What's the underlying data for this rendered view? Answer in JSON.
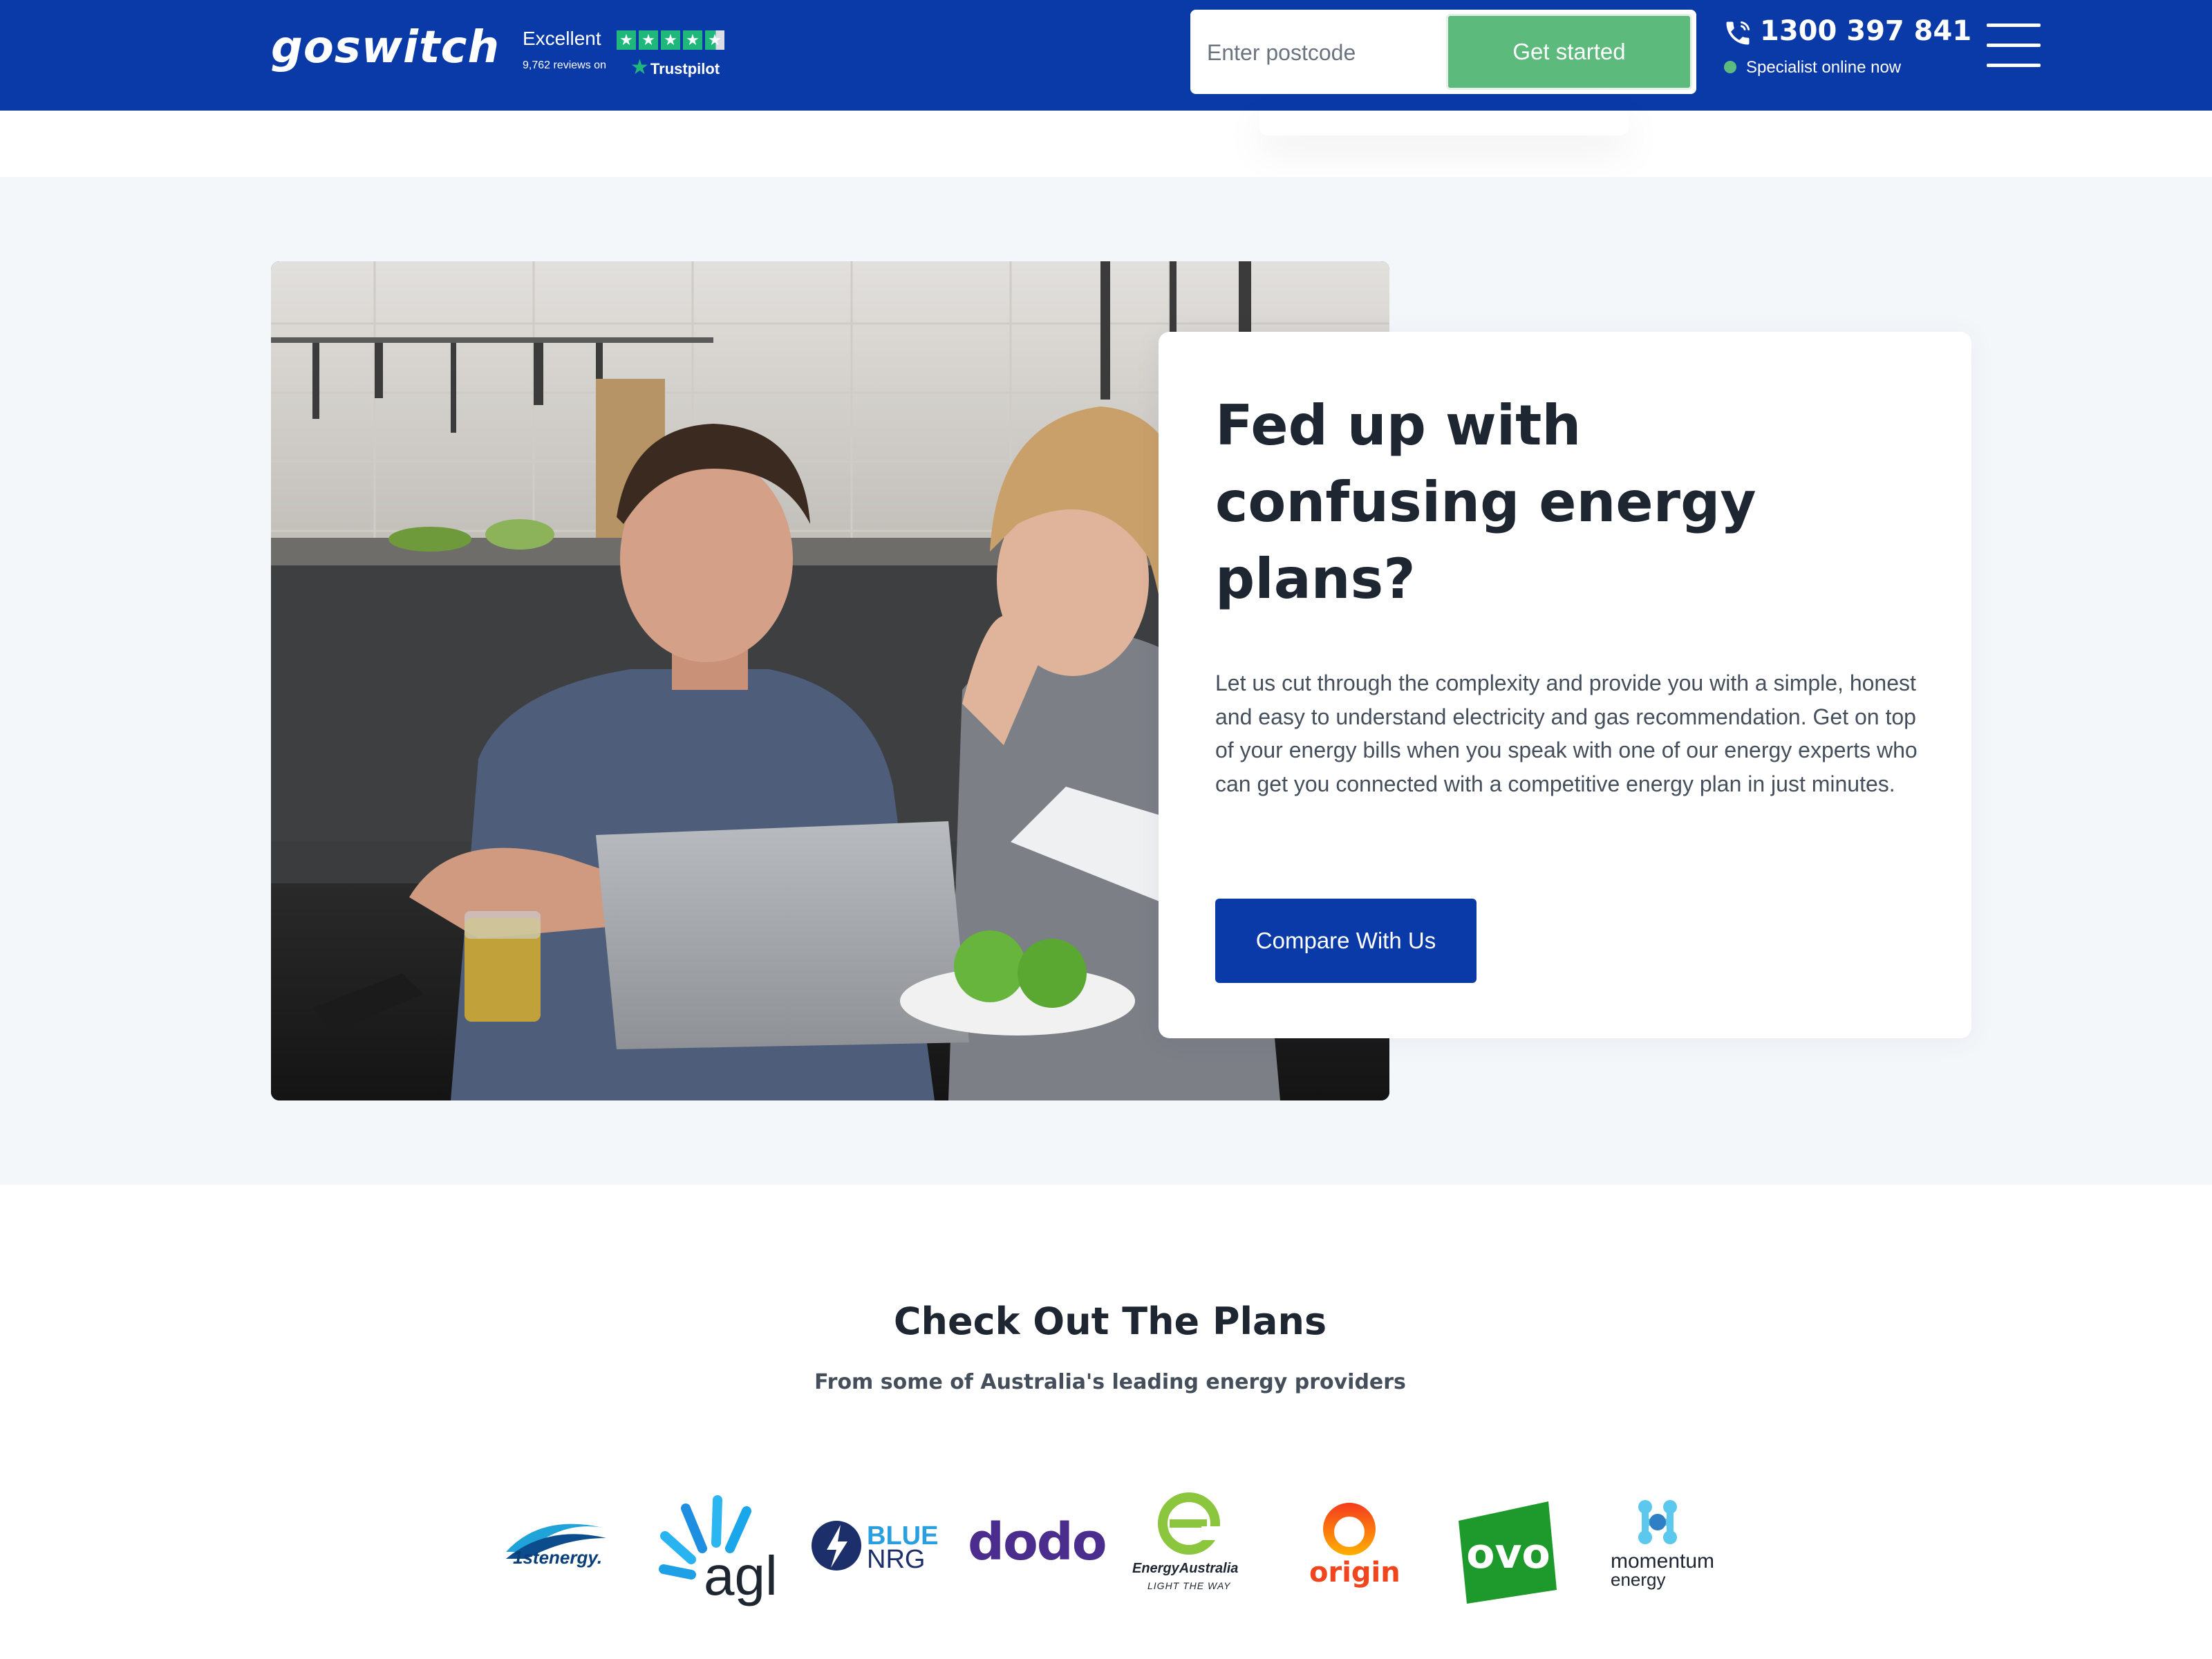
{
  "header": {
    "logo_text": "goswitch",
    "trustpilot": {
      "rating_word": "Excellent",
      "reviews": "9,762 reviews on",
      "brand": "Trustpilot"
    },
    "postcode_placeholder": "Enter postcode",
    "cta_label": "Get started",
    "phone": "1300 397 841",
    "online_status": "Specialist online now",
    "colors": {
      "bar": "#0a3aa8",
      "cta": "#5dba7d",
      "trustpilot": "#1fb87a"
    }
  },
  "hero": {
    "title": "Fed up with confusing energy plans?",
    "body": "Let us cut through the complexity and provide you with a simple, honest and easy to understand electricity and gas recommendation. Get on top of your energy bills when you speak with one of our energy experts who can get you connected with a competitive energy plan in just minutes.",
    "button_label": "Compare With Us",
    "photo_subject": "couple-reviewing-bills-at-laptop"
  },
  "plans": {
    "title": "Check Out The Plans",
    "subtitle": "From some of Australia's leading energy providers",
    "providers": [
      {
        "id": "1st-energy",
        "text": "1stenergy."
      },
      {
        "id": "agl",
        "text": "agl"
      },
      {
        "id": "blue-nrg",
        "text_top": "BLUE",
        "text_bottom": "NRG"
      },
      {
        "id": "dodo",
        "text": "dodo"
      },
      {
        "id": "energy-australia",
        "text": "EnergyAustralia",
        "tagline": "LIGHT THE WAY"
      },
      {
        "id": "origin",
        "text": "origin"
      },
      {
        "id": "ovo",
        "text": "ovo"
      },
      {
        "id": "momentum",
        "text": "momentum",
        "text_bottom": "energy"
      }
    ]
  }
}
